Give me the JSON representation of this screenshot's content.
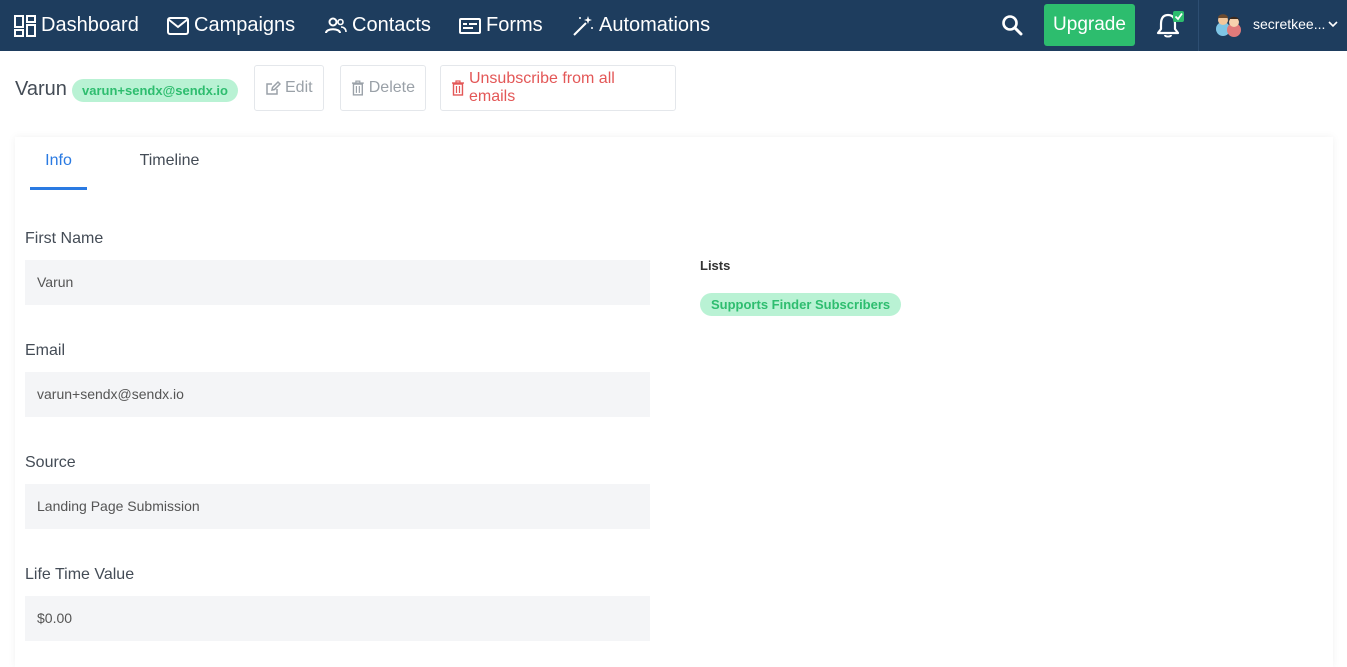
{
  "nav": {
    "dashboard": "Dashboard",
    "campaigns": "Campaigns",
    "contacts": "Contacts",
    "forms": "Forms",
    "automations": "Automations",
    "upgrade": "Upgrade",
    "username": "secretkee..."
  },
  "contact": {
    "name": "Varun",
    "email_badge": "varun+sendx@sendx.io"
  },
  "actions": {
    "edit": "Edit",
    "delete": "Delete",
    "unsubscribe": "Unsubscribe from all emails"
  },
  "tabs": {
    "info": "Info",
    "timeline": "Timeline"
  },
  "fields": [
    {
      "label": "First Name",
      "value": "Varun"
    },
    {
      "label": "Email",
      "value": "varun+sendx@sendx.io"
    },
    {
      "label": "Source",
      "value": "Landing Page Submission"
    },
    {
      "label": "Life Time Value",
      "value": "$0.00"
    }
  ],
  "lists": {
    "label": "Lists",
    "items": [
      "Supports Finder Subscribers"
    ]
  },
  "colors": {
    "nav_bg": "#1e3d5e",
    "upgrade": "#2dbd6e",
    "accent": "#2a7ae2",
    "danger": "#e35757",
    "badge_bg": "#b9f2d4",
    "badge_text": "#2ebd6f"
  }
}
